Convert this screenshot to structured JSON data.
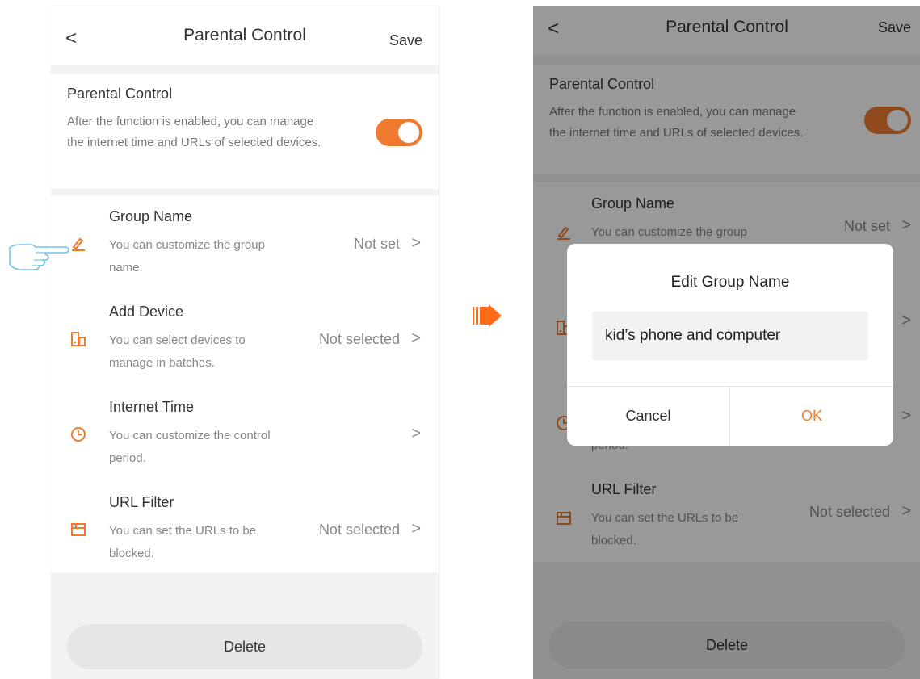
{
  "accent_color": "#f07a2f",
  "arrow_color": "#ff6a1a",
  "nav": {
    "back_glyph": "<",
    "title": "Parental Control",
    "save_label": "Save"
  },
  "parental_section": {
    "heading": "Parental Control",
    "description": "After the function is enabled, you can manage the internet time and URLs of selected devices.",
    "toggle_on": true
  },
  "items": [
    {
      "title": "Group Name",
      "subtitle": "You can customize the group name.",
      "value": "Not set",
      "icon": "pencil-icon"
    },
    {
      "title": "Add Device",
      "subtitle": "You can select devices to manage in batches.",
      "value": "Not selected",
      "icon": "device-icon"
    },
    {
      "title": "Internet Time",
      "subtitle": "You can customize the control period.",
      "value": "",
      "icon": "clock-icon"
    },
    {
      "title": "URL Filter",
      "subtitle": "You can set the URLs to be blocked.",
      "value": "Not selected",
      "icon": "url-filter-icon"
    }
  ],
  "chevron_glyph": ">",
  "delete_label": "Delete",
  "dialog": {
    "title": "Edit Group Name",
    "input_value": "kid’s phone and computer",
    "cancel_label": "Cancel",
    "ok_label": "OK"
  }
}
